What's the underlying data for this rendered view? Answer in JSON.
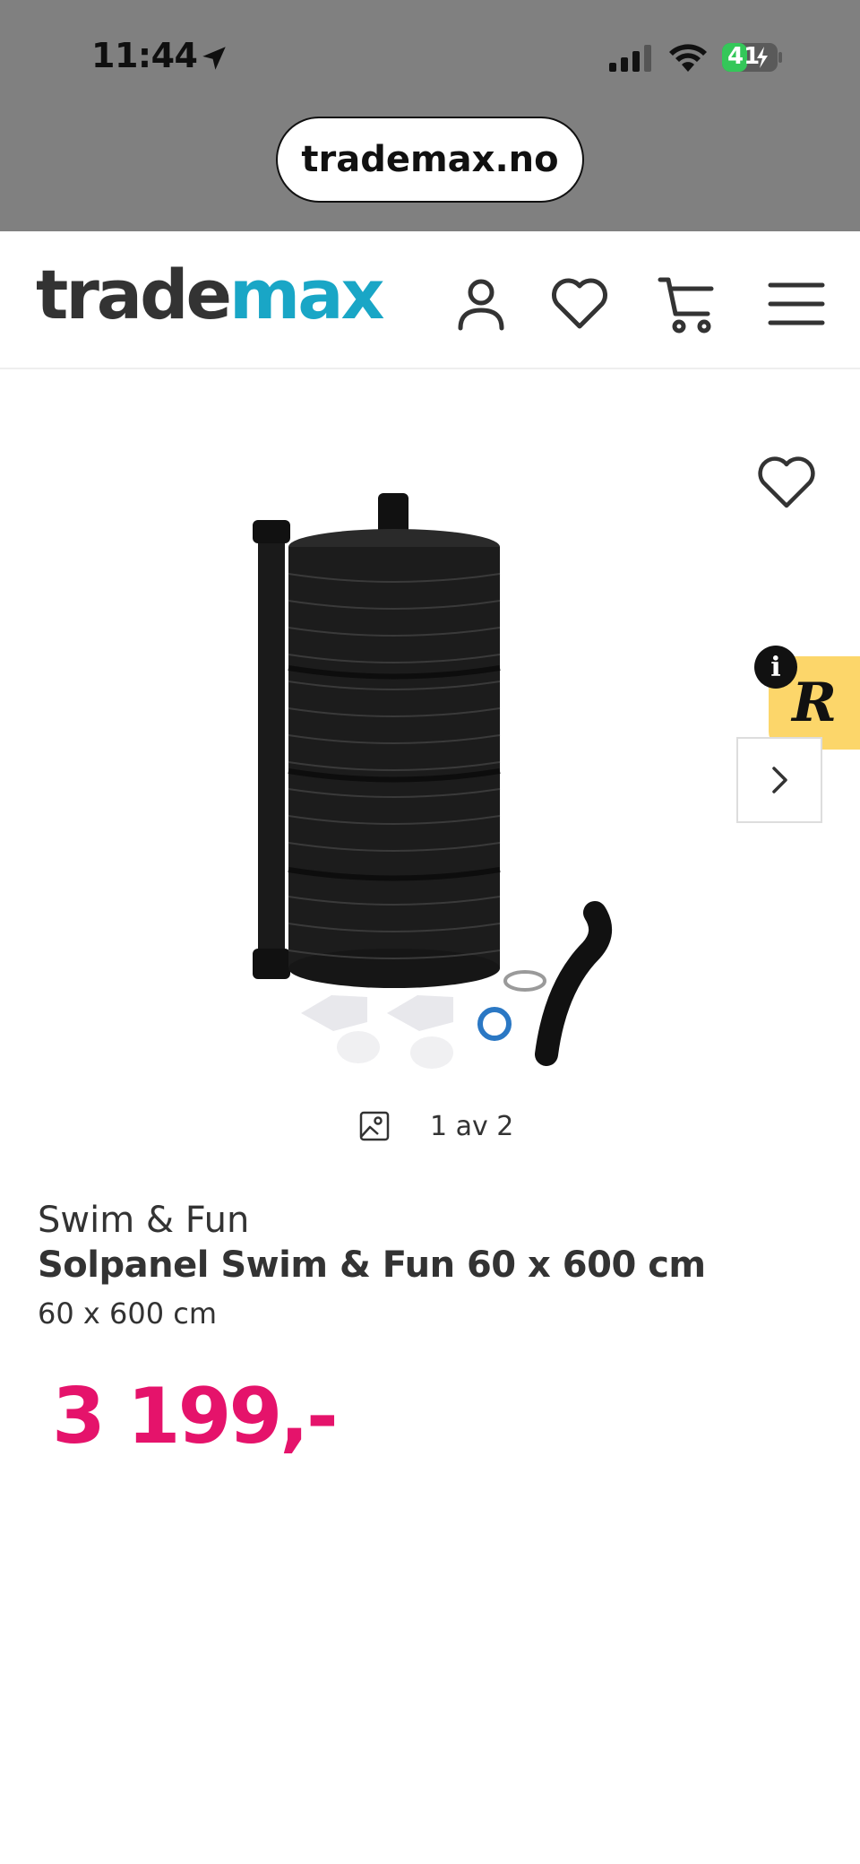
{
  "status_bar": {
    "time": "11:44",
    "battery": "41"
  },
  "browser": {
    "url": "trademax.no"
  },
  "header": {
    "logo_part1": "trade",
    "logo_part2": "max",
    "icons": [
      "account-icon",
      "heart-icon",
      "cart-icon",
      "menu-icon"
    ]
  },
  "gallery": {
    "counter": "1 av 2"
  },
  "product": {
    "brand": "Swim & Fun",
    "title": "Solpanel Swim & Fun 60 x 600 cm",
    "variant": "60 x 600 cm",
    "price": "3 199,-"
  },
  "colors": {
    "brand_blue": "#19a6c6",
    "price_pink": "#e5136b",
    "badge_yellow": "#fcd66a",
    "chrome_gray": "#808080"
  }
}
